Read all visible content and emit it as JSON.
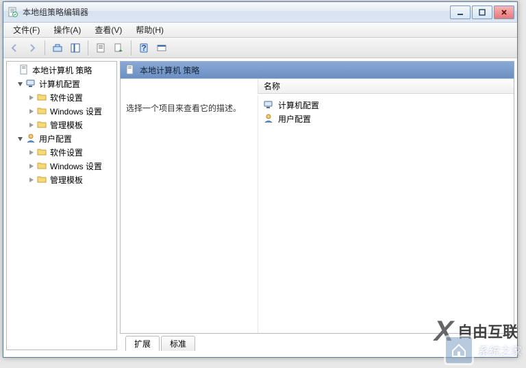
{
  "window": {
    "title": "本地组策略编辑器"
  },
  "menu": {
    "file": "文件(F)",
    "action": "操作(A)",
    "view": "查看(V)",
    "help": "帮助(H)"
  },
  "tree": {
    "root": "本地计算机 策略",
    "computer": "计算机配置",
    "user": "用户配置",
    "software": "软件设置",
    "windows": "Windows 设置",
    "admin": "管理模板"
  },
  "details": {
    "heading": "本地计算机 策略",
    "prompt": "选择一个项目来查看它的描述。",
    "col_name": "名称",
    "items": {
      "computer": "计算机配置",
      "user": "用户配置"
    }
  },
  "tabs": {
    "extended": "扩展",
    "standard": "标准"
  },
  "watermark": {
    "brand": "自由互联",
    "sub": "系统之家"
  }
}
